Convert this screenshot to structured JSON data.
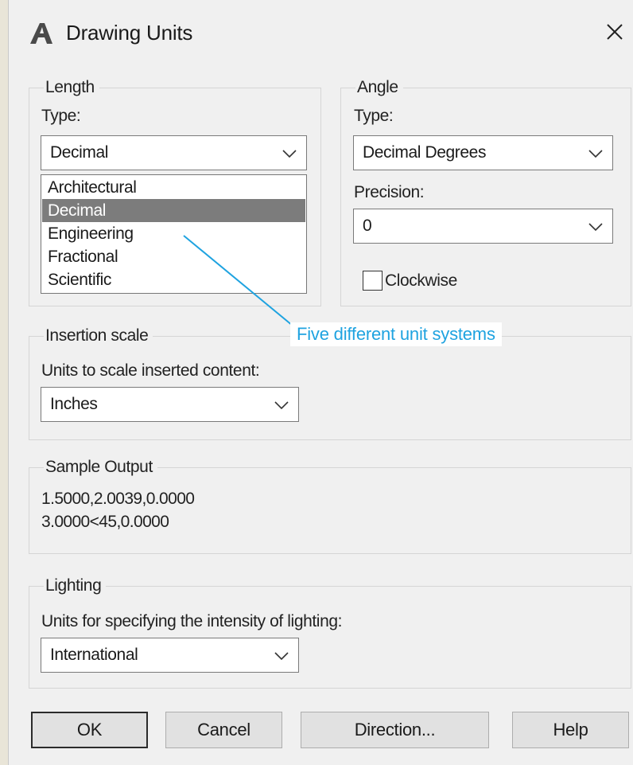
{
  "window": {
    "title": "Drawing Units",
    "icon": "autocad-a-logo-icon",
    "close_icon": "close-x-icon"
  },
  "length": {
    "legend": "Length",
    "type_label": "Type:",
    "type_value": "Decimal",
    "options": [
      "Architectural",
      "Decimal",
      "Engineering",
      "Fractional",
      "Scientific"
    ],
    "selected_option": "Decimal"
  },
  "angle": {
    "legend": "Angle",
    "type_label": "Type:",
    "type_value": "Decimal Degrees",
    "precision_label": "Precision:",
    "precision_value": "0",
    "clockwise_label": "Clockwise",
    "clockwise_checked": false
  },
  "annotation": {
    "text": "Five different unit systems",
    "color": "#1fa3e0"
  },
  "insertion": {
    "legend": "Insertion scale",
    "label": "Units to scale inserted content:",
    "value": "Inches"
  },
  "sample": {
    "legend": "Sample Output",
    "line1": "1.5000,2.0039,0.0000",
    "line2": "3.0000<45,0.0000"
  },
  "lighting": {
    "legend": "Lighting",
    "label": "Units for specifying the intensity of lighting:",
    "value": "International"
  },
  "buttons": {
    "ok": "OK",
    "cancel": "Cancel",
    "direction": "Direction...",
    "help": "Help"
  },
  "colors": {
    "dialog_bg": "#f0f0f0",
    "selection": "#7c7c7c",
    "outer_bg": "#e9e5d8"
  }
}
